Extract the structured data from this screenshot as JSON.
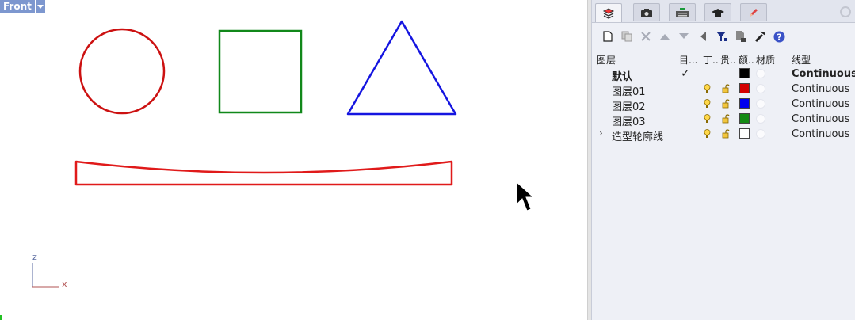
{
  "viewport": {
    "label": "Front",
    "axis_z": "z",
    "axis_x": "x"
  },
  "shapes": [
    {
      "kind": "circle",
      "color": "#cc1111"
    },
    {
      "kind": "square",
      "color": "#11881a"
    },
    {
      "kind": "triangle",
      "color": "#1515e0"
    },
    {
      "kind": "curved-slab",
      "color": "#e01a1a"
    }
  ],
  "panel": {
    "tabs": [
      "layers-tab",
      "camera-tab",
      "keyboard-tab",
      "graduation-cap-tab",
      "pencil-tab"
    ],
    "columns": [
      "图层",
      "目...",
      "丁..",
      "贵..",
      "颜..",
      "材质",
      "线型"
    ],
    "layers": [
      {
        "name": "默认",
        "current": true,
        "color": "#000000",
        "linetype": "Continuous",
        "bold": true
      },
      {
        "name": "图层01",
        "current": false,
        "color": "#d40000",
        "linetype": "Continuous",
        "bold": false
      },
      {
        "name": "图层02",
        "current": false,
        "color": "#0000ee",
        "linetype": "Continuous",
        "bold": false
      },
      {
        "name": "图层03",
        "current": false,
        "color": "#138a13",
        "linetype": "Continuous",
        "bold": false
      },
      {
        "name": "造型轮廓线",
        "current": false,
        "color": "#ffffff",
        "linetype": "Continuous",
        "bold": false,
        "expandable": true
      }
    ]
  }
}
